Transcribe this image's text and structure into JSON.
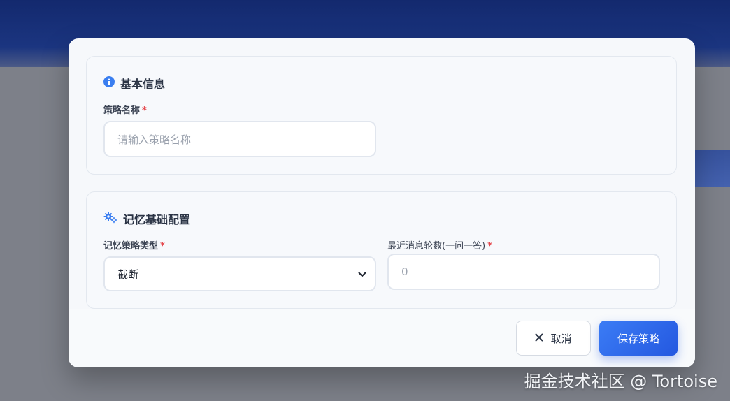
{
  "basic_section": {
    "title": "基本信息",
    "icon": "info-circle-icon",
    "strategy_name": {
      "label": "策略名称",
      "required_mark": "*",
      "value": "",
      "placeholder": "请输入策略名称"
    }
  },
  "memory_section": {
    "title": "记忆基础配置",
    "icon": "gears-icon",
    "strategy_type": {
      "label": "记忆策略类型",
      "required_mark": "*",
      "selected": "截断"
    },
    "recent_rounds": {
      "label": "最近消息轮数(一问一答)",
      "required_mark": "*",
      "value": "",
      "placeholder": "0"
    }
  },
  "footer": {
    "cancel_label": "取消",
    "save_label": "保存策略"
  },
  "colors": {
    "accent": "#2f6ae8",
    "required": "#e5484d",
    "overlay_header": "#1b3580"
  },
  "watermark": "掘金技术社区 @ Tortoise"
}
